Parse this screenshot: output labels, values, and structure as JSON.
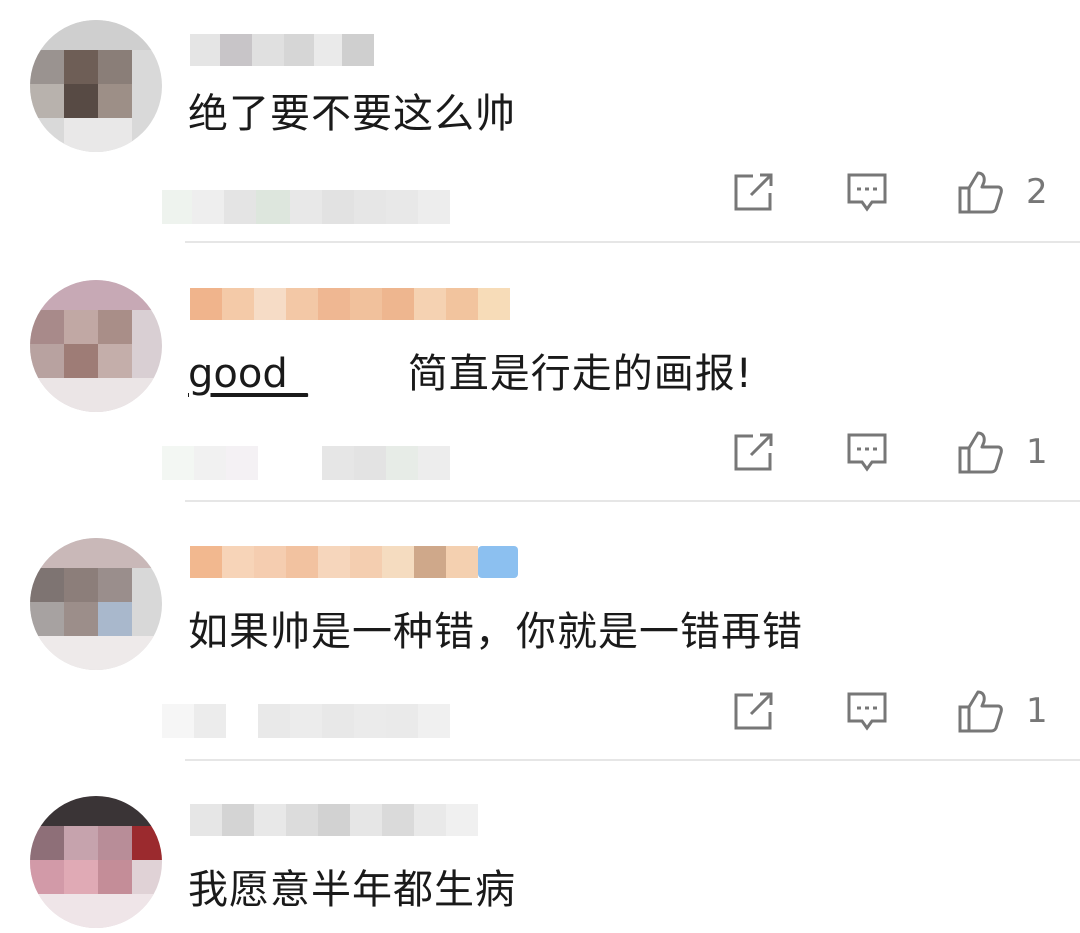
{
  "comments": [
    {
      "text": "绝了要不要这么帅",
      "likes": "2"
    },
    {
      "tag": "good_",
      "text": "简直是行走的画报!",
      "likes": "1"
    },
    {
      "text": "如果帅是一种错，你就是一错再错",
      "likes": "1"
    },
    {
      "text": "我愿意半年都生病"
    }
  ],
  "icons": {
    "share": "share-icon",
    "reply": "reply-icon",
    "like": "thumbs-up-icon"
  },
  "colors": {
    "icon": "#777777",
    "divider": "#e6e6e6",
    "text": "#1a1a1a"
  }
}
